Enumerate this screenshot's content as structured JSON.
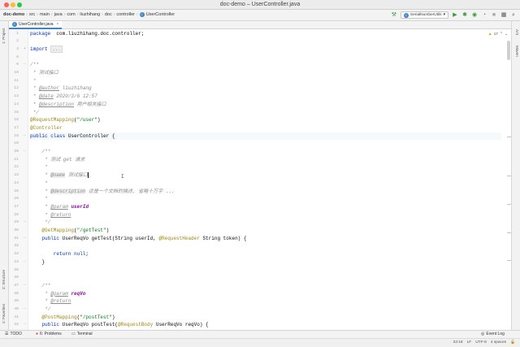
{
  "window": {
    "title": "doc-demo – UserController.java"
  },
  "breadcrumbs": [
    "doc-demo",
    "src",
    "main",
    "java",
    "com",
    "liuzhihang",
    "doc",
    "controller",
    "UserController"
  ],
  "toolbar": {
    "run_config": "SerialNumberUtils"
  },
  "tab": {
    "label": "UserController.java"
  },
  "inspection": {
    "warnings": "17"
  },
  "side_left": {
    "project": "1: Project",
    "structure": "Z: Structure",
    "favorites": "2: Favorites"
  },
  "side_right": {
    "ant": "Ant",
    "maven": "Maven"
  },
  "bottom_tools": {
    "todo": "TODO",
    "problems": "6: Problems",
    "terminal": "Terminal",
    "event_log": "Event Log"
  },
  "status": {
    "position": "23:18",
    "line_sep": "LF",
    "encoding": "UTF-8",
    "indent": "4 spaces"
  },
  "editor": {
    "current_line": 13,
    "lines": [
      {
        "n": "1",
        "t": [
          [
            "kw",
            "package"
          ],
          [
            "",
            "  com.liuzhihang.doc.controller;"
          ]
        ]
      },
      {
        "n": "2",
        "t": []
      },
      {
        "n": "3",
        "t": [
          [
            "kw",
            "import"
          ],
          [
            "",
            " "
          ],
          [
            "fold",
            "..."
          ]
        ]
      },
      {
        "n": "8",
        "t": []
      },
      {
        "n": "9",
        "t": [
          [
            "cmt",
            "/**"
          ]
        ]
      },
      {
        "n": "10",
        "t": [
          [
            "cmt",
            " * 测试接口"
          ]
        ]
      },
      {
        "n": "11",
        "t": [
          [
            "cmt",
            " *"
          ]
        ]
      },
      {
        "n": "12",
        "t": [
          [
            "cmt",
            " * "
          ],
          [
            "tag",
            "@author"
          ],
          [
            "cmt",
            " liuzhihang"
          ]
        ]
      },
      {
        "n": "13",
        "t": [
          [
            "cmt",
            " * "
          ],
          [
            "tag",
            "@date"
          ],
          [
            "cmt",
            " 2020/3/6 12:57"
          ]
        ]
      },
      {
        "n": "14",
        "t": [
          [
            "cmt",
            " * "
          ],
          [
            "tag",
            "@description"
          ],
          [
            "cmt",
            " 用户相关接口"
          ]
        ]
      },
      {
        "n": "15",
        "t": [
          [
            "cmt",
            " */"
          ]
        ]
      },
      {
        "n": "16",
        "t": [
          [
            "ann",
            "@RequestMapping"
          ],
          [
            "",
            "("
          ],
          [
            "str",
            "\"/user\""
          ],
          [
            "",
            ")"
          ]
        ]
      },
      {
        "n": "17",
        "t": [
          [
            "ann",
            "@Controller"
          ]
        ]
      },
      {
        "n": "18",
        "t": [
          [
            "kw",
            "public class"
          ],
          [
            "",
            " UserController {"
          ]
        ]
      },
      {
        "n": "19",
        "t": []
      },
      {
        "n": "20",
        "t": [
          [
            "cmt",
            "    /**"
          ]
        ]
      },
      {
        "n": "21",
        "t": [
          [
            "cmt",
            "     * 测试 get 请求"
          ]
        ]
      },
      {
        "n": "22",
        "t": [
          [
            "cmt",
            "     *"
          ]
        ]
      },
      {
        "n": "23",
        "t": [
          [
            "cmt",
            "     * "
          ],
          [
            "tagbox",
            "@name"
          ],
          [
            "cmt",
            " 测试接口"
          ],
          [
            "cursor",
            ""
          ]
        ]
      },
      {
        "n": "24",
        "t": [
          [
            "cmt",
            "     *"
          ]
        ]
      },
      {
        "n": "25",
        "t": [
          [
            "cmt",
            "     * "
          ],
          [
            "tagbox",
            "@description"
          ],
          [
            "cmt",
            " 这是一个文档的描述, 省略十万字 ..."
          ]
        ]
      },
      {
        "n": "26",
        "t": [
          [
            "cmt",
            "     *"
          ]
        ]
      },
      {
        "n": "27",
        "t": [
          [
            "cmt",
            "     * "
          ],
          [
            "tag",
            "@param"
          ],
          [
            "cmt",
            " "
          ],
          [
            "param",
            "userId"
          ]
        ]
      },
      {
        "n": "28",
        "t": [
          [
            "cmt",
            "     * "
          ],
          [
            "tag",
            "@return"
          ]
        ]
      },
      {
        "n": "29",
        "t": [
          [
            "cmt",
            "     */"
          ]
        ]
      },
      {
        "n": "30",
        "t": [
          [
            "ann",
            "    @GetMapping"
          ],
          [
            "",
            "("
          ],
          [
            "str",
            "\"/getTest\""
          ],
          [
            "",
            ")"
          ]
        ]
      },
      {
        "n": "31",
        "t": [
          [
            "kw",
            "    public"
          ],
          [
            "",
            " UserReqVo getTest(String userId, "
          ],
          [
            "ann",
            "@RequestHeader"
          ],
          [
            "",
            " String token) {"
          ]
        ]
      },
      {
        "n": "32",
        "t": []
      },
      {
        "n": "33",
        "t": [
          [
            "kw",
            "        return null"
          ],
          [
            "",
            ";"
          ]
        ]
      },
      {
        "n": "34",
        "t": [
          [
            "",
            "    }"
          ]
        ]
      },
      {
        "n": "35",
        "t": []
      },
      {
        "n": "36",
        "t": []
      },
      {
        "n": "37",
        "t": [
          [
            "cmt",
            "    /**"
          ]
        ]
      },
      {
        "n": "38",
        "t": [
          [
            "cmt",
            "     * "
          ],
          [
            "tag",
            "@param"
          ],
          [
            "cmt",
            " "
          ],
          [
            "param",
            "reqVo"
          ]
        ]
      },
      {
        "n": "39",
        "t": [
          [
            "cmt",
            "     * "
          ],
          [
            "tag",
            "@return"
          ]
        ]
      },
      {
        "n": "40",
        "t": [
          [
            "cmt",
            "     */"
          ]
        ]
      },
      {
        "n": "41",
        "t": [
          [
            "ann",
            "    @PostMapping"
          ],
          [
            "",
            "("
          ],
          [
            "str",
            "\"/postTest\""
          ],
          [
            "",
            ")"
          ]
        ]
      },
      {
        "n": "42",
        "t": [
          [
            "kw",
            "    public"
          ],
          [
            "",
            " UserReqVo postTest("
          ],
          [
            "ann",
            "@RequestBody"
          ],
          [
            "",
            " UserReqVo reqVo) {"
          ]
        ]
      }
    ]
  },
  "colors": {
    "accent": "#4083c9",
    "keyword": "#0033b3",
    "annotation": "#9e880d",
    "string": "#067d17",
    "comment": "#8c8c8c"
  }
}
